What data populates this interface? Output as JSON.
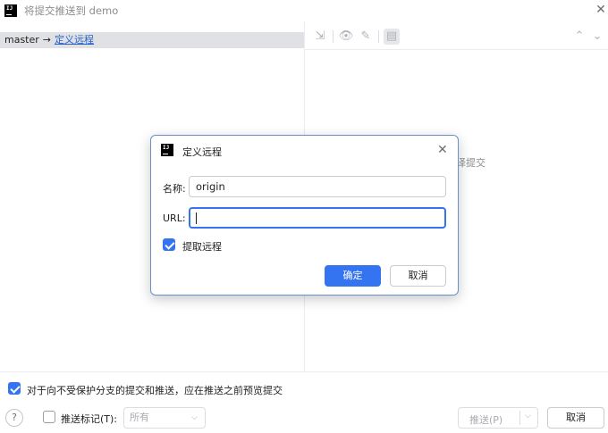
{
  "window": {
    "title": "将提交推送到 demo",
    "close_icon": "close-icon"
  },
  "branch_row": {
    "local_branch": "master",
    "arrow": "→",
    "remote_link": "定义远程"
  },
  "right_panel": {
    "empty_hint": "译提交",
    "toolbar_icons": [
      "collapse-icon",
      "eye-icon",
      "pencil-icon",
      "layout-icon",
      "expand-vertical-icon",
      "collapse-vertical-icon"
    ]
  },
  "footer": {
    "preview_checkbox_label": "对于向不受保护分支的提交和推送，应在推送之前预览提交",
    "preview_checked": true,
    "push_tags_label": "推送标记(T):",
    "push_tags_checked": false,
    "tags_select_value": "所有",
    "push_button_label": "推送(P)",
    "cancel_button_label": "取消",
    "help_label": "?"
  },
  "dialog": {
    "title": "定义远程",
    "name_label": "名称:",
    "name_value": "origin",
    "url_label": "URL:",
    "url_value": "",
    "fetch_checkbox_label": "提取远程",
    "fetch_checked": true,
    "ok_button_label": "确定",
    "cancel_button_label": "取消"
  },
  "colors": {
    "accent": "#3574f0",
    "link": "#2a62c9",
    "branch_row_bg": "#dfe1e5"
  }
}
